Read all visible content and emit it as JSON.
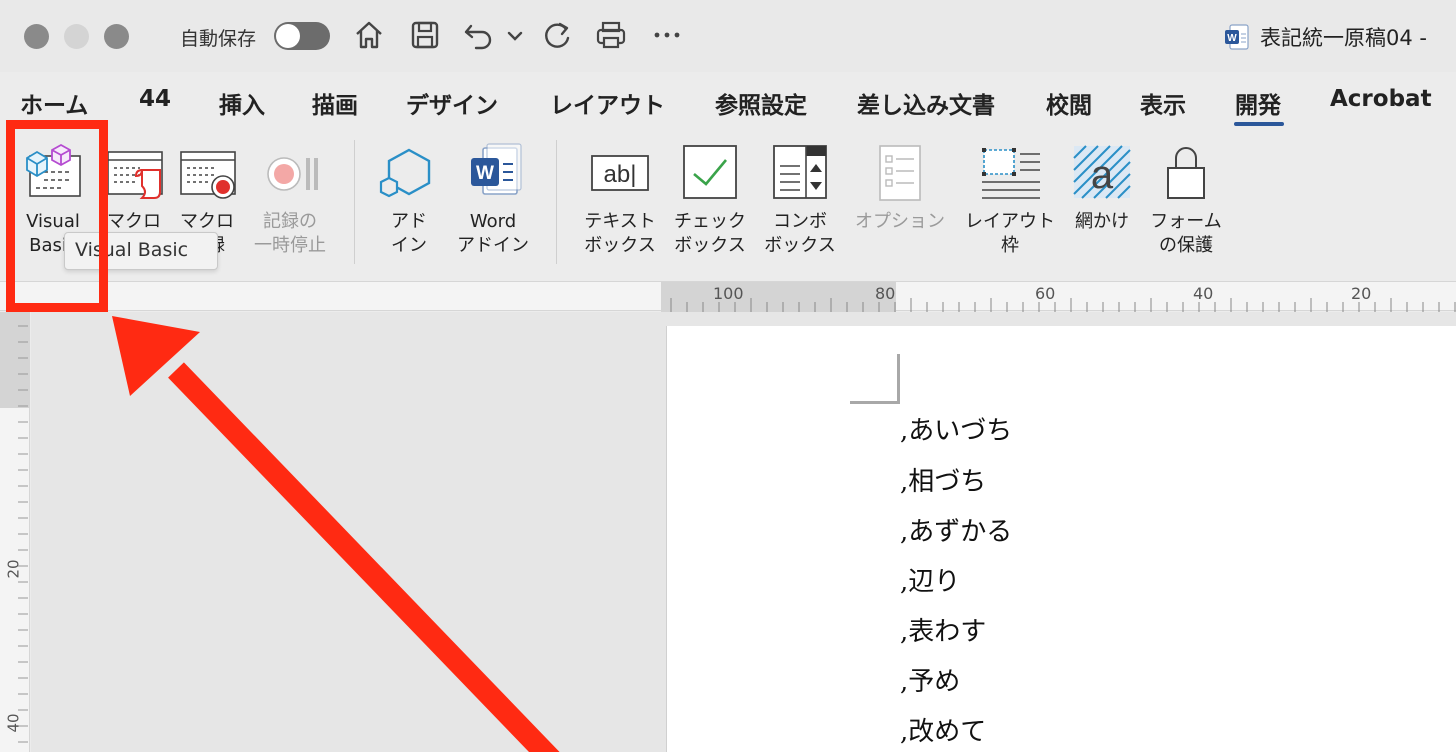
{
  "titlebar": {
    "autosave_label": "自動保存",
    "document_title": "表記統一原稿04 - "
  },
  "menu": {
    "tabs": [
      {
        "label": "ホーム"
      },
      {
        "label": "44"
      },
      {
        "label": "挿入"
      },
      {
        "label": "描画"
      },
      {
        "label": "デザイン"
      },
      {
        "label": "レイアウト"
      },
      {
        "label": "参照設定"
      },
      {
        "label": "差し込み文書"
      },
      {
        "label": "校閲"
      },
      {
        "label": "表示"
      },
      {
        "label": "開発"
      },
      {
        "label": "Acrobat"
      }
    ],
    "active_tab": "開発"
  },
  "ribbon": {
    "visual_basic": {
      "line1": "Visual",
      "line2": "Basic"
    },
    "macro": {
      "line1": "マクロ",
      "line2": ""
    },
    "macro_record": {
      "line1": "マクロ",
      "line2": "記録"
    },
    "record_pause": {
      "line1": "記録の",
      "line2": "一時停止"
    },
    "addin": {
      "line1": "アド",
      "line2": "イン"
    },
    "word_addin": {
      "line1": "Word",
      "line2": "アドイン"
    },
    "textbox": {
      "line1": "テキスト",
      "line2": "ボックス",
      "icon_text": "ab|"
    },
    "checkbox": {
      "line1": "チェック",
      "line2": "ボックス"
    },
    "combobox": {
      "line1": "コンボ",
      "line2": "ボックス"
    },
    "options": {
      "line1": "オプション"
    },
    "layout_frame": {
      "line1": "レイアウト",
      "line2": "枠"
    },
    "shading": {
      "line1": "網かけ",
      "icon_text": "a"
    },
    "protect_form": {
      "line1": "フォーム",
      "line2": "の保護"
    }
  },
  "tooltip": {
    "text": "Visual Basic"
  },
  "ruler": {
    "horizontal": [
      "100",
      "80",
      "60",
      "40",
      "20"
    ],
    "vertical": [
      "20",
      "40"
    ]
  },
  "document": {
    "lines": [
      ",あいづち",
      ",相づち",
      ",あずかる",
      ",辺り",
      ",表わす",
      ",予め",
      ",改めて"
    ]
  },
  "colors": {
    "annotation_red": "#ff2a12",
    "accent_blue": "#2b579a"
  }
}
